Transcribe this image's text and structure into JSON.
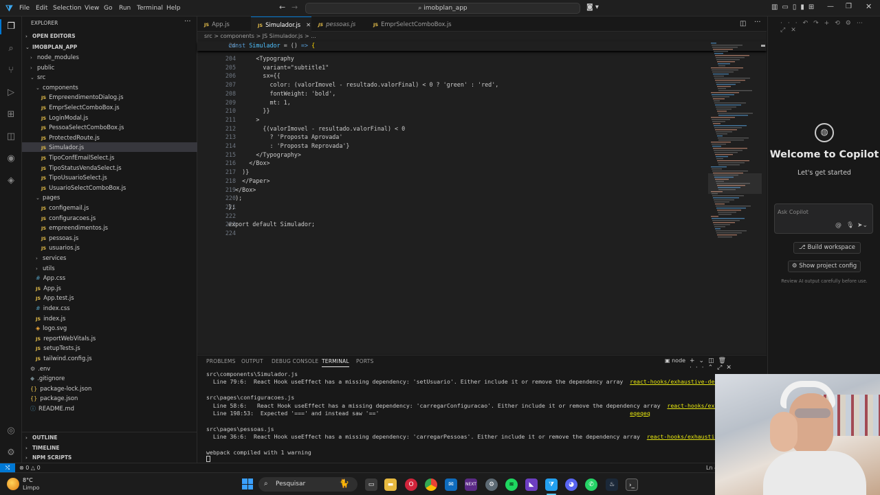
{
  "window": {
    "title_search": "imobplan_app"
  },
  "menu": [
    "File",
    "Edit",
    "Selection",
    "View",
    "Go",
    "Run",
    "Terminal",
    "Help"
  ],
  "explorer": {
    "title": "EXPLORER",
    "open_editors": "OPEN EDITORS",
    "project": "IMOBPLAN_APP",
    "items": [
      {
        "label": "node_modules",
        "kind": "folder",
        "depth": 1,
        "open": false
      },
      {
        "label": "public",
        "kind": "folder",
        "depth": 1,
        "open": false
      },
      {
        "label": "src",
        "kind": "folder",
        "depth": 1,
        "open": true
      },
      {
        "label": "components",
        "kind": "folder",
        "depth": 2,
        "open": true
      },
      {
        "label": "EmpreendimentoDialog.js",
        "kind": "js",
        "depth": 3
      },
      {
        "label": "EmprSelectComboBox.js",
        "kind": "js",
        "depth": 3
      },
      {
        "label": "LoginModal.js",
        "kind": "js",
        "depth": 3
      },
      {
        "label": "PessoaSelectComboBox.js",
        "kind": "js",
        "depth": 3
      },
      {
        "label": "ProtectedRoute.js",
        "kind": "js",
        "depth": 3
      },
      {
        "label": "Simulador.js",
        "kind": "js",
        "depth": 3,
        "selected": true
      },
      {
        "label": "TipoConfEmailSelect.js",
        "kind": "js",
        "depth": 3
      },
      {
        "label": "TipoStatusVendaSelect.js",
        "kind": "js",
        "depth": 3
      },
      {
        "label": "TipoUsuarioSelect.js",
        "kind": "js",
        "depth": 3
      },
      {
        "label": "UsuarioSelectComboBox.js",
        "kind": "js",
        "depth": 3
      },
      {
        "label": "pages",
        "kind": "folder",
        "depth": 2,
        "open": true
      },
      {
        "label": "configemail.js",
        "kind": "js",
        "depth": 3
      },
      {
        "label": "configuracoes.js",
        "kind": "js",
        "depth": 3
      },
      {
        "label": "empreendimentos.js",
        "kind": "js",
        "depth": 3
      },
      {
        "label": "pessoas.js",
        "kind": "js",
        "depth": 3
      },
      {
        "label": "usuarios.js",
        "kind": "js",
        "depth": 3
      },
      {
        "label": "services",
        "kind": "folder",
        "depth": 2,
        "open": false
      },
      {
        "label": "utils",
        "kind": "folder",
        "depth": 2,
        "open": false
      },
      {
        "label": "App.css",
        "kind": "css",
        "depth": 2
      },
      {
        "label": "App.js",
        "kind": "js",
        "depth": 2
      },
      {
        "label": "App.test.js",
        "kind": "js",
        "depth": 2
      },
      {
        "label": "index.css",
        "kind": "css",
        "depth": 2
      },
      {
        "label": "index.js",
        "kind": "js",
        "depth": 2
      },
      {
        "label": "logo.svg",
        "kind": "svg",
        "depth": 2
      },
      {
        "label": "reportWebVitals.js",
        "kind": "js",
        "depth": 2
      },
      {
        "label": "setupTests.js",
        "kind": "js",
        "depth": 2
      },
      {
        "label": "tailwind.config.js",
        "kind": "js",
        "depth": 2
      },
      {
        "label": ".env",
        "kind": "env",
        "depth": 1
      },
      {
        "label": ".gitignore",
        "kind": "git",
        "depth": 1
      },
      {
        "label": "package-lock.json",
        "kind": "json",
        "depth": 1
      },
      {
        "label": "package.json",
        "kind": "json",
        "depth": 1
      },
      {
        "label": "README.md",
        "kind": "md",
        "depth": 1
      }
    ],
    "outline": "OUTLINE",
    "timeline": "TIMELINE",
    "npm": "NPM SCRIPTS"
  },
  "tabs": [
    {
      "label": "App.js",
      "active": false,
      "italic": false
    },
    {
      "label": "Simulador.js",
      "active": true,
      "italic": false
    },
    {
      "label": "pessoas.js",
      "active": false,
      "italic": true
    },
    {
      "label": "EmprSelectComboBox.js",
      "active": false,
      "italic": false
    }
  ],
  "breadcrumb": "src > components > JS Simulador.js > ...",
  "sticky": {
    "line": "24",
    "code": "const Simulador = () => {"
  },
  "code_lines": [
    {
      "n": "204",
      "t": "        <Typography"
    },
    {
      "n": "205",
      "t": "          variant=\"subtitle1\""
    },
    {
      "n": "206",
      "t": "          sx={{"
    },
    {
      "n": "207",
      "t": "            color: (valorImovel - resultado.valorFinal) < 0 ? 'green' : 'red',"
    },
    {
      "n": "208",
      "t": "            fontWeight: 'bold',"
    },
    {
      "n": "209",
      "t": "            mt: 1,"
    },
    {
      "n": "210",
      "t": "          }}"
    },
    {
      "n": "211",
      "t": "        >"
    },
    {
      "n": "212",
      "t": "          {(valorImovel - resultado.valorFinal) < 0"
    },
    {
      "n": "213",
      "t": "            ? 'Proposta Aprovada'"
    },
    {
      "n": "214",
      "t": "            : 'Proposta Reprovada'}"
    },
    {
      "n": "215",
      "t": "        </Typography>"
    },
    {
      "n": "216",
      "t": "      </Box>"
    },
    {
      "n": "217",
      "t": "    )}"
    },
    {
      "n": "218",
      "t": "    </Paper>"
    },
    {
      "n": "219",
      "t": "  </Box>"
    },
    {
      "n": "220",
      "t": "  );"
    },
    {
      "n": "221",
      "t": "};"
    },
    {
      "n": "222",
      "t": ""
    },
    {
      "n": "223",
      "t": "export default Simulador;"
    },
    {
      "n": "224",
      "t": ""
    }
  ],
  "panel": {
    "tabs": [
      "PROBLEMS",
      "OUTPUT",
      "DEBUG CONSOLE",
      "TERMINAL",
      "PORTS"
    ],
    "active": "TERMINAL",
    "shell": "node",
    "lines": [
      {
        "t": "src\\components\\Simulador.js",
        "link": ""
      },
      {
        "t": "  Line 79:6:  React Hook useEffect has a missing dependency: 'setUsuario'. Either include it or remove the dependency array  ",
        "link": "react-hooks/exhaustive-deps"
      },
      {
        "t": "",
        "link": ""
      },
      {
        "t": "src\\pages\\configuracoes.js",
        "link": ""
      },
      {
        "t": "  Line 58:6:   React Hook useEffect has a missing dependency: 'carregarConfiguracao'. Either include it or remove the dependency array  ",
        "link": "react-hooks/exhaustive"
      },
      {
        "t": "  Line 198:53:  Expected '===' and instead saw '=='                                                                          ",
        "link": "eqeqeq"
      },
      {
        "t": "",
        "link": ""
      },
      {
        "t": "src\\pages\\pessoas.js",
        "link": ""
      },
      {
        "t": "  Line 36:6:  React Hook useEffect has a missing dependency: 'carregarPessoas'. Either include it or remove the dependency array  ",
        "link": "react-hooks/exhaustive-deps"
      },
      {
        "t": "",
        "link": ""
      },
      {
        "t": "webpack compiled with 1 warning",
        "link": ""
      }
    ]
  },
  "copilot": {
    "title": "Welcome to Copilot",
    "subtitle": "Let's get started",
    "placeholder": "Ask Copilot",
    "build": "Build workspace",
    "config": "Show project config",
    "note": "Review AI output carefully before use."
  },
  "status": {
    "errors": "0",
    "warnings": "0",
    "position": "Ln 4"
  },
  "taskbar": {
    "weather_temp": "8°C",
    "weather_desc": "Limpo",
    "search": "Pesquisar"
  }
}
